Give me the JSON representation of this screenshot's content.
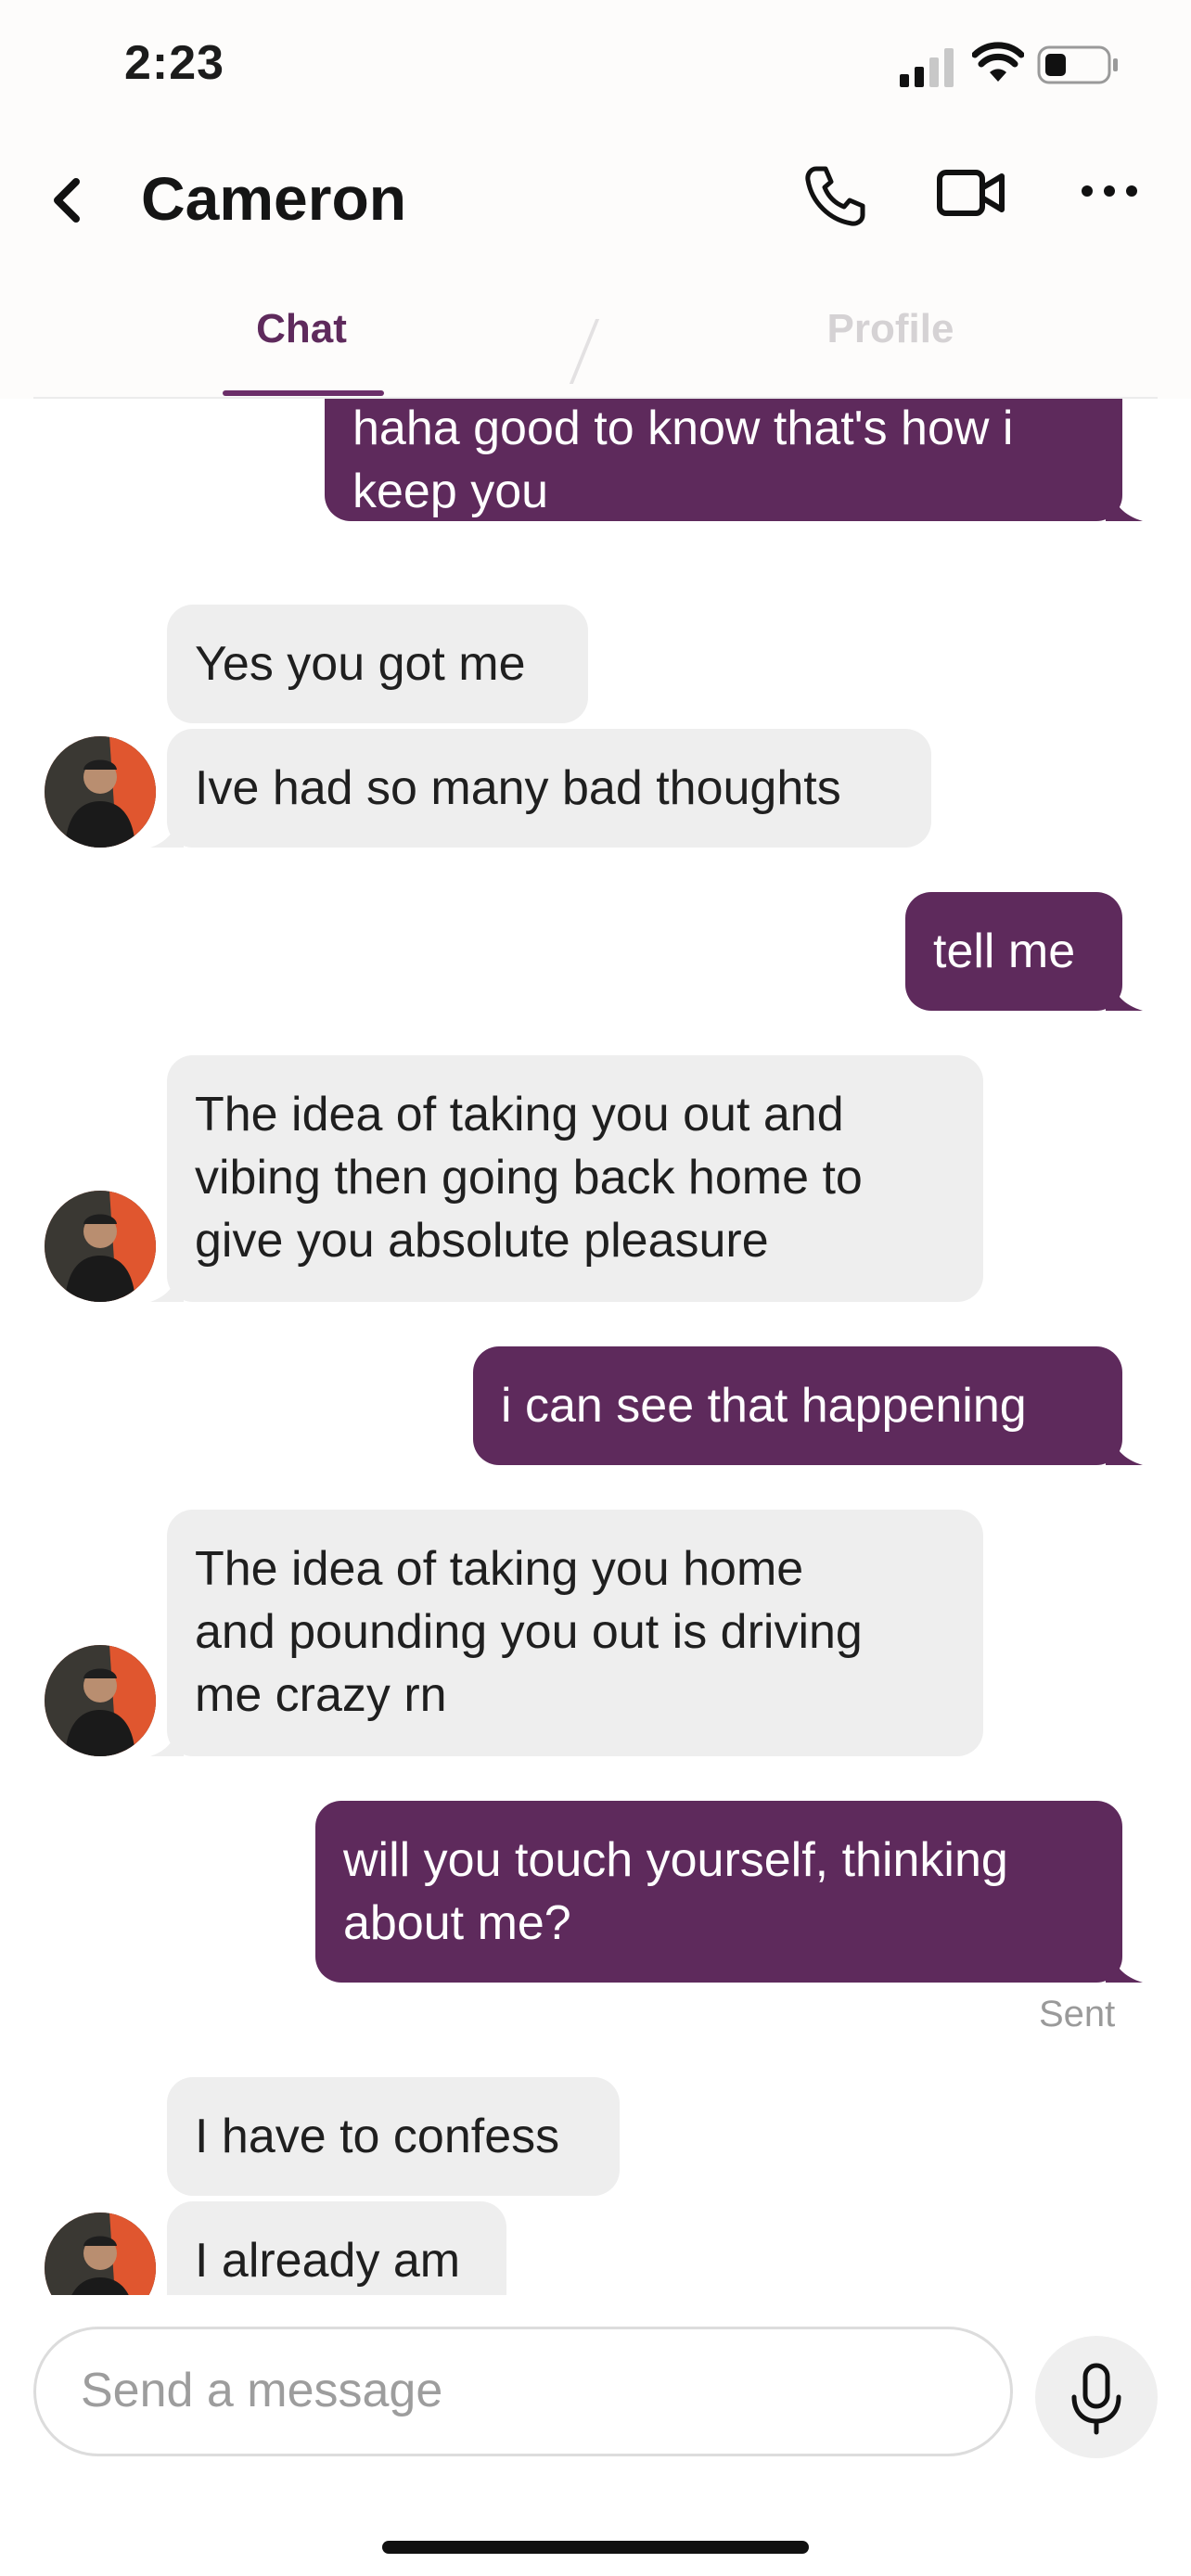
{
  "status_bar": {
    "time": "2:23"
  },
  "header": {
    "contact_name": "Cameron",
    "tabs": {
      "chat": "Chat",
      "profile": "Profile"
    }
  },
  "messages": [
    {
      "direction": "outgoing",
      "lines": [
        "haha good to know that's how i",
        "keep you"
      ]
    },
    {
      "direction": "incoming",
      "lines": [
        "Yes you got me"
      ]
    },
    {
      "direction": "incoming",
      "lines": [
        "Ive had so many bad thoughts"
      ]
    },
    {
      "direction": "outgoing",
      "lines": [
        "tell me"
      ]
    },
    {
      "direction": "incoming",
      "lines": [
        "The idea of taking you out and",
        "vibing then going back home to",
        "give you absolute pleasure"
      ]
    },
    {
      "direction": "outgoing",
      "lines": [
        "i can see that happening"
      ]
    },
    {
      "direction": "incoming",
      "lines": [
        "The idea of taking you home",
        "and pounding you out is driving",
        "me crazy rn"
      ]
    },
    {
      "direction": "outgoing",
      "lines": [
        "will you touch yourself, thinking",
        "about me?"
      ]
    },
    {
      "direction": "incoming",
      "lines": [
        "I have to confess"
      ]
    },
    {
      "direction": "incoming",
      "lines": [
        "I already am"
      ]
    }
  ],
  "delivery_status": "Sent",
  "composer": {
    "placeholder": "Send a message"
  },
  "colors": {
    "accent": "#5e2a5c",
    "incoming_bubble": "#eeeeee",
    "tab_inactive": "#d5d2d4"
  },
  "icons": [
    "back-chevron-icon",
    "phone-icon",
    "video-camera-icon",
    "more-icon",
    "microphone-icon"
  ]
}
